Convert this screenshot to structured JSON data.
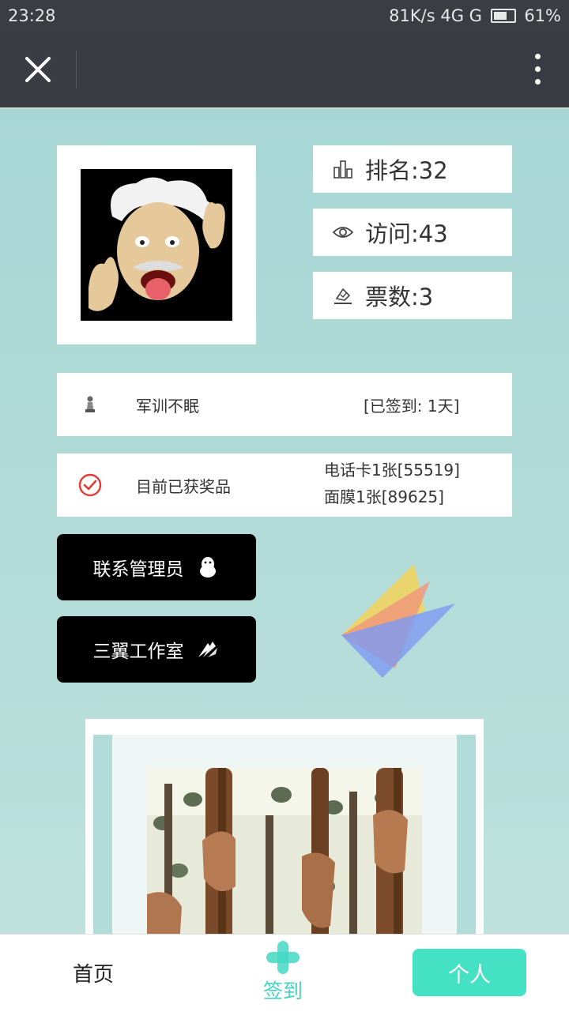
{
  "status_bar": {
    "time": "23:28",
    "right": "81K/s  4G  G",
    "battery": "61%"
  },
  "nav": {
    "close_icon": "close-icon",
    "more_icon": "more-vertical-icon"
  },
  "profile": {
    "avatar_icon": "avatar-einstein-cartoon",
    "stats": [
      {
        "icon": "bar-chart-icon",
        "text": "排名:32"
      },
      {
        "icon": "eye-icon",
        "text": "访问:43"
      },
      {
        "icon": "vote-icon",
        "text": "票数:3"
      }
    ]
  },
  "info_rows": {
    "checkin": {
      "icon": "chess-pawn-icon",
      "label": "军训不眠",
      "status": "[已签到: 1天]"
    },
    "prizes": {
      "icon": "check-circle-icon",
      "label": "目前已获奖品",
      "items": [
        "电话卡1张[55519]",
        "面膜1张[89625]"
      ]
    }
  },
  "buttons": {
    "contact_admin": "联系管理员",
    "studio": "三翼工作室"
  },
  "tabbar": {
    "home": "首页",
    "sign": "签到",
    "me": "个人"
  },
  "colors": {
    "background": "#a9d8d6",
    "accent": "#45e1c5",
    "nav": "#393c42",
    "check": "#e53935"
  }
}
